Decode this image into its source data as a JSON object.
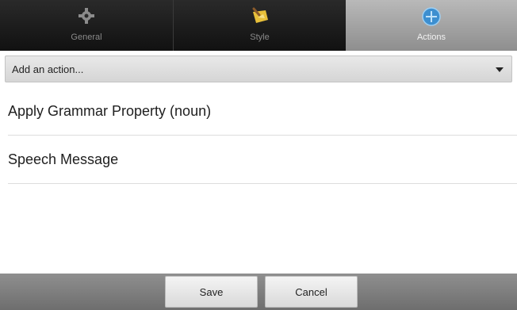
{
  "tabs": [
    {
      "label": "General",
      "icon": "gear-icon",
      "selected": false
    },
    {
      "label": "Style",
      "icon": "paint-brush-icon",
      "selected": false
    },
    {
      "label": "Actions",
      "icon": "actions-globe-icon",
      "selected": true
    }
  ],
  "dropdown": {
    "value": "Add an action..."
  },
  "actions": [
    {
      "label": "Apply Grammar Property (noun)"
    },
    {
      "label": "Speech Message"
    }
  ],
  "footer": {
    "save_label": "Save",
    "cancel_label": "Cancel"
  },
  "colors": {
    "tab_bar": "#1c1c1c",
    "selected_tab": "#a8a8a8",
    "footer_bar": "#7d7d7d"
  }
}
